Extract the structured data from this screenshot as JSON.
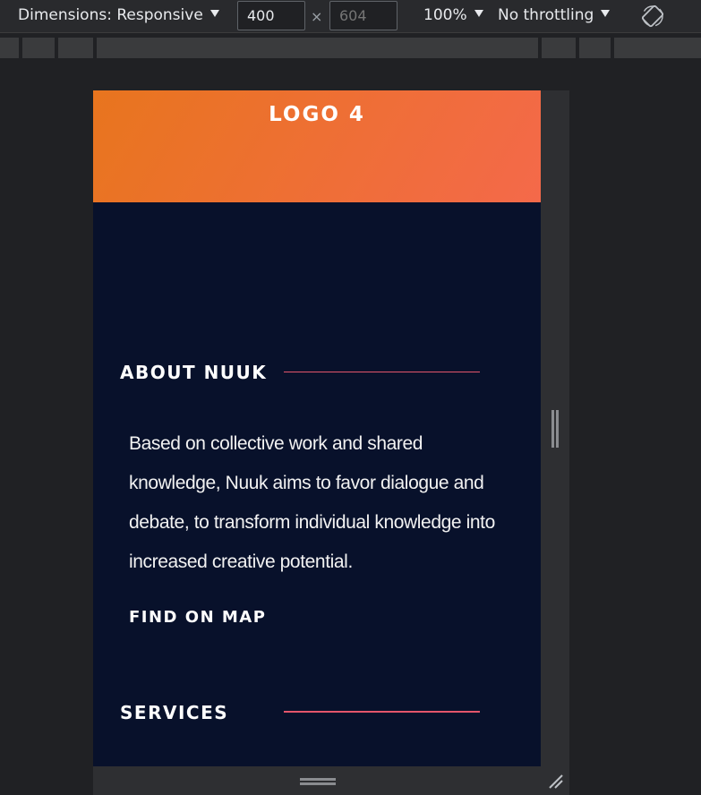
{
  "toolbar": {
    "dimensions_label": "Dimensions: Responsive",
    "width_value": "400",
    "height_placeholder": "604",
    "times_symbol": "×",
    "zoom_label": "100%",
    "throttling_label": "No throttling"
  },
  "icons": {
    "rotate": "rotate-icon",
    "resize_corner": "resize-corner-icon",
    "dropdown": "caret-down-icon"
  },
  "site": {
    "logo": "LOGO 4",
    "about": {
      "title": "ABOUT NUUK",
      "text": "Based on collective work and shared knowledge, Nuuk aims to favor dialogue and debate, to transform individual knowledge into increased creative potential.",
      "link": "FIND ON MAP"
    },
    "services": {
      "title": "SERVICES"
    }
  },
  "colors": {
    "header_gradient_start": "#e8751e",
    "header_gradient_end": "#f4694a",
    "page_background": "#08112b",
    "accent_line": "#e4556b"
  }
}
